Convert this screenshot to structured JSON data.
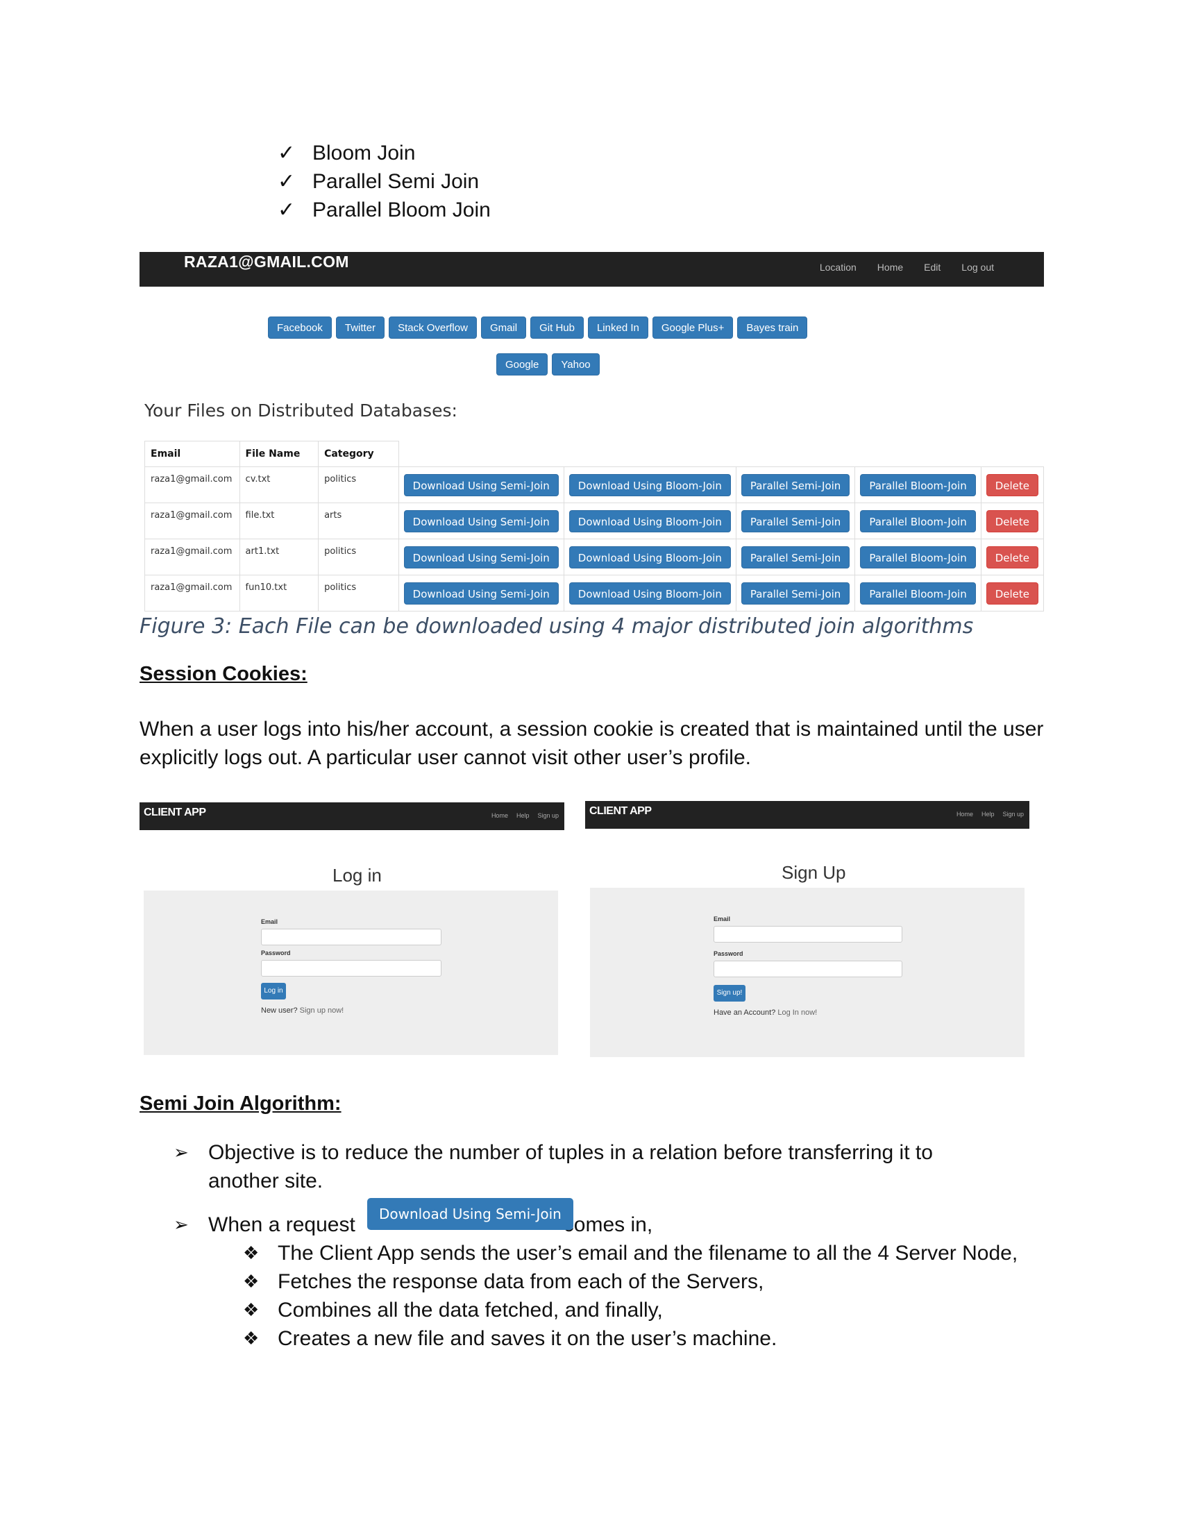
{
  "checklist": [
    "Bloom Join",
    "Parallel Semi Join",
    "Parallel Bloom Join"
  ],
  "checkmark": "✓",
  "screenshot1": {
    "brand": "RAZA1@GMAIL.COM",
    "nav_links": [
      "Location",
      "Home",
      "Edit",
      "Log out"
    ],
    "social_row1": [
      "Facebook",
      "Twitter",
      "Stack Overflow",
      "Gmail",
      "Git Hub",
      "Linked In",
      "Google Plus+",
      "Bayes train"
    ],
    "social_row2": [
      "Google",
      "Yahoo"
    ],
    "files_heading": "Your Files on Distributed Databases:",
    "columns": [
      "Email",
      "File Name",
      "Category"
    ],
    "rows": [
      {
        "email": "raza1@gmail.com",
        "file": "cv.txt",
        "category": "politics"
      },
      {
        "email": "raza1@gmail.com",
        "file": "file.txt",
        "category": "arts"
      },
      {
        "email": "raza1@gmail.com",
        "file": "art1.txt",
        "category": "politics"
      },
      {
        "email": "raza1@gmail.com",
        "file": "fun10.txt",
        "category": "politics"
      }
    ],
    "row_actions": [
      "Download Using Semi-Join",
      "Download Using Bloom-Join",
      "Parallel Semi-Join",
      "Parallel Bloom-Join",
      "Delete"
    ]
  },
  "caption": "Figure 3: Each File can be downloaded using 4 major distributed join algorithms",
  "session_heading": "Session Cookies:",
  "session_paragraph": "When a user logs into his/her account, a session cookie is created that is maintained until the user explicitly logs out. A particular user cannot visit other user’s profile.",
  "login_shot": {
    "brand": "CLIENT APP",
    "nav_links": [
      "Home",
      "Help",
      "Sign up"
    ],
    "title": "Log in",
    "email_label": "Email",
    "password_label": "Password",
    "button": "Log in",
    "note_prefix": "New user? ",
    "note_link": "Sign up now!"
  },
  "signup_shot": {
    "brand": "CLIENT APP",
    "nav_links": [
      "Home",
      "Help",
      "Sign up"
    ],
    "title": "Sign Up",
    "email_label": "Email",
    "password_label": "Password",
    "button": "Sign up!",
    "note_prefix": "Have an Account? ",
    "note_link": "Log In now!"
  },
  "semi_heading": "Semi Join Algorithm:",
  "semi_bullets": {
    "b1_line1": "Objective is to reduce the number of tuples in a relation before transferring it to",
    "b1_line2": "another site.",
    "b2_prefix": "When a request",
    "b2_button": "Download Using Semi-Join",
    "b2_suffix": "comes in,",
    "sub": [
      "The Client App sends the user’s email and the filename to all the 4 Server Node,",
      "Fetches the response data from each of the Servers,",
      "Combines all the data fetched, and finally,",
      "Creates a new file and saves it on the user’s machine."
    ]
  }
}
